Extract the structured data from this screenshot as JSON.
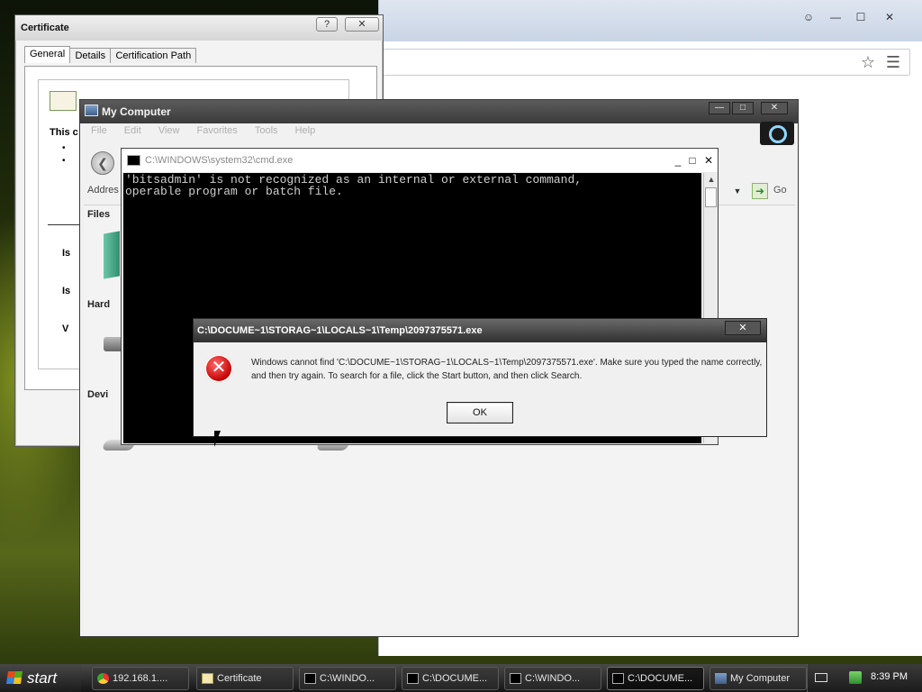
{
  "browser": {
    "controls": [
      "✕",
      "☐",
      "—",
      "☺"
    ]
  },
  "certificate": {
    "title": "Certificate",
    "tabs": [
      "General",
      "Details",
      "Certification Path"
    ],
    "line1": "This c",
    "fragments": [
      "Is",
      "Is",
      "V"
    ]
  },
  "my_computer": {
    "title": "My Computer",
    "menu": [
      "File",
      "Edit",
      "View",
      "Favorites",
      "Tools",
      "Help"
    ],
    "address_label": "Addres",
    "go_label": "Go",
    "side_labels": [
      "Files",
      "Hard",
      "Devi"
    ]
  },
  "cmd": {
    "title": "C:\\WINDOWS\\system32\\cmd.exe",
    "output": "'bitsadmin' is not recognized as an internal or external command,\noperable program or batch file."
  },
  "error_dialog": {
    "title": "C:\\DOCUME~1\\STORAG~1\\LOCALS~1\\Temp\\2097375571.exe",
    "message": "Windows cannot find 'C:\\DOCUME~1\\STORAG~1\\LOCALS~1\\Temp\\2097375571.exe'. Make sure you typed the name correctly, and then try again. To search for a file, click the Start button, and then click Search.",
    "ok_label": "OK"
  },
  "taskbar": {
    "start_label": "start",
    "items": [
      {
        "label": "192.168.1....",
        "icon": "chrome-icon"
      },
      {
        "label": "Certificate",
        "icon": "certificate-icon"
      },
      {
        "label": "C:\\WINDO...",
        "icon": "cmd-icon"
      },
      {
        "label": "C:\\DOCUME...",
        "icon": "cmd-icon"
      },
      {
        "label": "C:\\WINDO...",
        "icon": "cmd-icon"
      },
      {
        "label": "C:\\DOCUME...",
        "icon": "cmd-icon"
      },
      {
        "label": "My Computer",
        "icon": "computer-icon"
      }
    ],
    "clock": "8:39 PM"
  }
}
